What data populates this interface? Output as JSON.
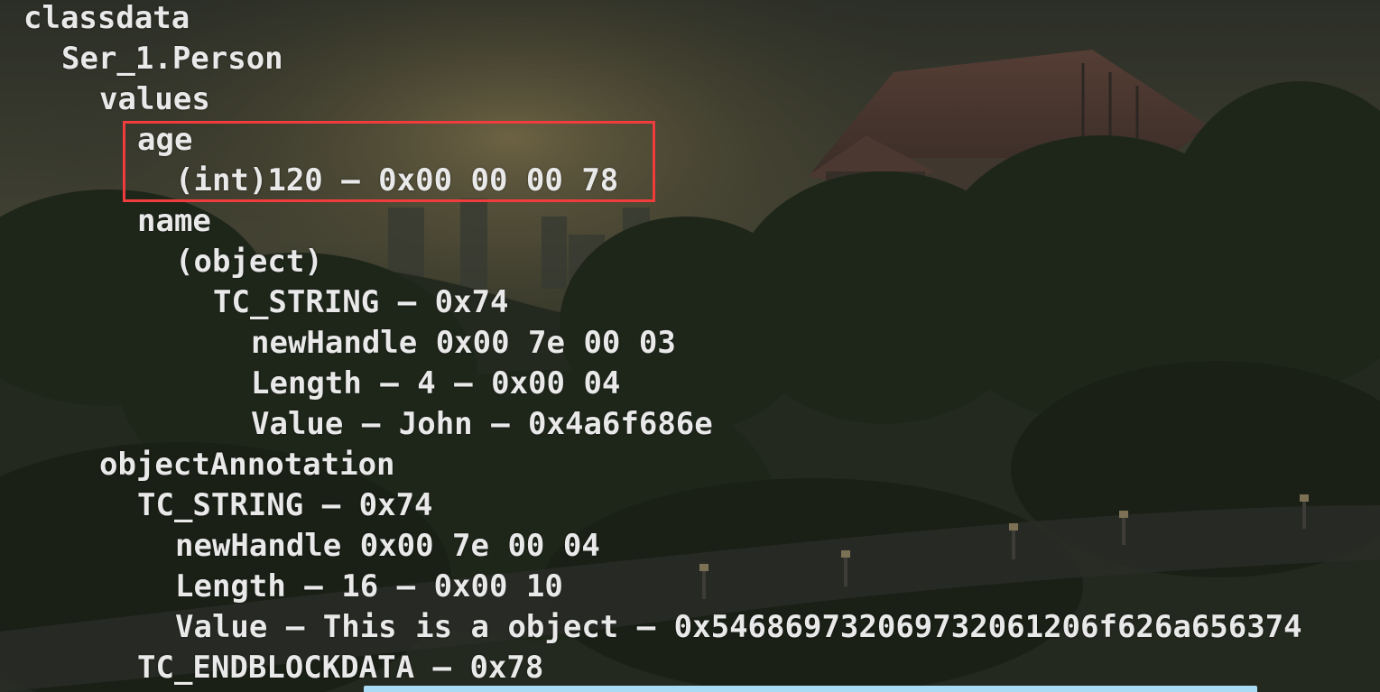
{
  "terminal": {
    "highlight_color": "#f03c3c",
    "text_color": "#e9e9e9",
    "lines": [
      {
        "indent": 0,
        "text": "classdata"
      },
      {
        "indent": 1,
        "text": "Ser_1.Person"
      },
      {
        "indent": 2,
        "text": "values"
      },
      {
        "indent": 3,
        "text": "age"
      },
      {
        "indent": 4,
        "text": "(int)120 – 0x00 00 00 78"
      },
      {
        "indent": 3,
        "text": "name"
      },
      {
        "indent": 4,
        "text": "(object)"
      },
      {
        "indent": 5,
        "text": "TC_STRING – 0x74"
      },
      {
        "indent": 6,
        "text": "newHandle 0x00 7e 00 03"
      },
      {
        "indent": 6,
        "text": "Length – 4 – 0x00 04"
      },
      {
        "indent": 6,
        "text": "Value – John – 0x4a6f686e"
      },
      {
        "indent": 2,
        "text": "objectAnnotation"
      },
      {
        "indent": 3,
        "text": "TC_STRING – 0x74"
      },
      {
        "indent": 4,
        "text": "newHandle 0x00 7e 00 04"
      },
      {
        "indent": 4,
        "text": "Length – 16 – 0x00 10"
      },
      {
        "indent": 4,
        "text": "Value – This is a object – 0x546869732069732061206f626a656374"
      },
      {
        "indent": 3,
        "text": "TC_ENDBLOCKDATA – 0x78"
      }
    ]
  }
}
